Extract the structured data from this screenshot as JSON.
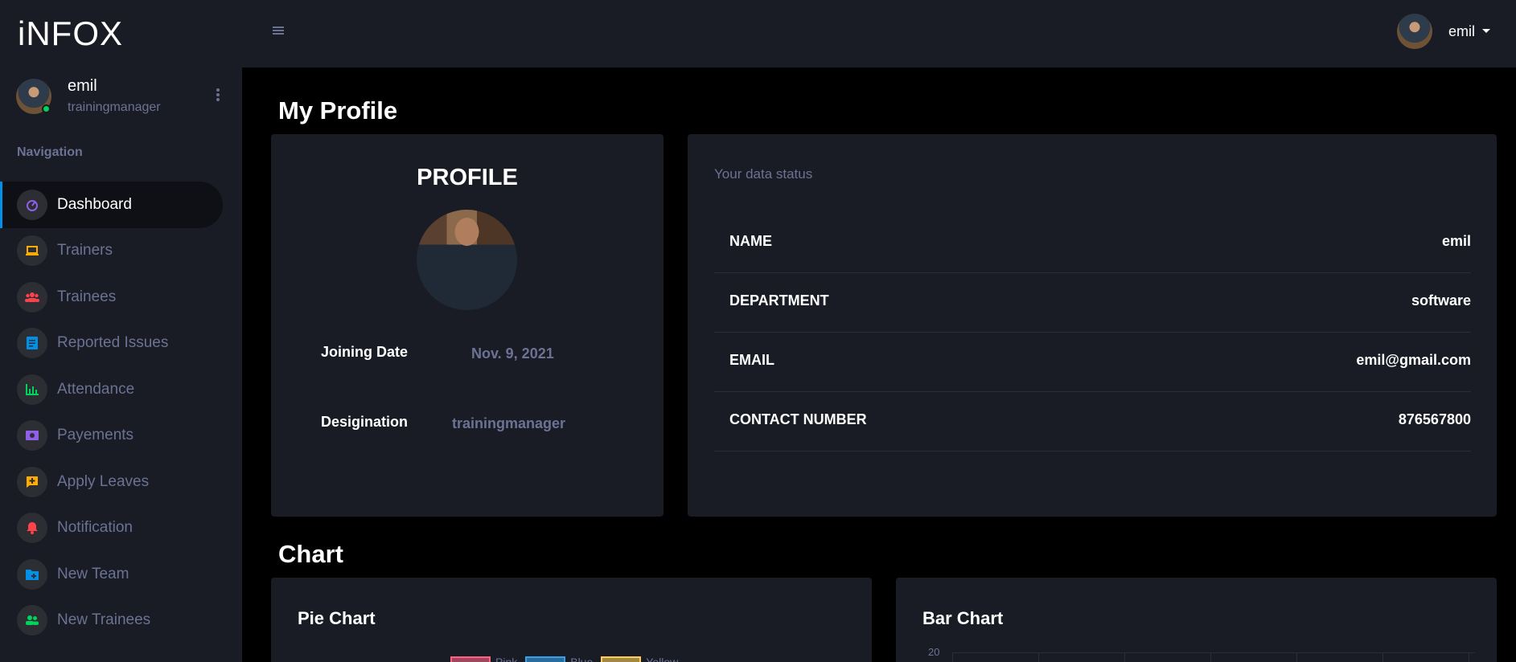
{
  "brand": "iNFOX",
  "user": {
    "name": "emil",
    "role": "trainingmanager"
  },
  "nav": {
    "label": "Navigation",
    "items": [
      {
        "label": "Dashboard",
        "icon": "speedometer-icon",
        "color": "#8f5fe8",
        "active": true
      },
      {
        "label": "Trainers",
        "icon": "laptop-icon",
        "color": "#ffab00"
      },
      {
        "label": "Trainees",
        "icon": "users-icon",
        "color": "#fc424a"
      },
      {
        "label": "Reported Issues",
        "icon": "document-icon",
        "color": "#0090e7"
      },
      {
        "label": "Attendance",
        "icon": "bar-chart-icon",
        "color": "#00d25b"
      },
      {
        "label": "Payements",
        "icon": "money-icon",
        "color": "#8f5fe8"
      },
      {
        "label": "Apply Leaves",
        "icon": "message-plus-icon",
        "color": "#ffab00"
      },
      {
        "label": "Notification",
        "icon": "bell-icon",
        "color": "#fc424a"
      },
      {
        "label": "New Team",
        "icon": "folder-plus-icon",
        "color": "#0090e7"
      },
      {
        "label": "New Trainees",
        "icon": "user-group-icon",
        "color": "#00d25b"
      }
    ]
  },
  "topbar": {
    "username": "emil"
  },
  "profile_section": {
    "title": "My Profile",
    "card_title": "PROFILE",
    "joining_date_label": "Joining Date",
    "joining_date_value": "Nov. 9, 2021",
    "designation_label": "Desigination",
    "designation_value": "trainingmanager"
  },
  "status": {
    "heading": "Your data status",
    "rows": [
      {
        "key": "NAME",
        "value": "emil"
      },
      {
        "key": "DEPARTMENT",
        "value": "software"
      },
      {
        "key": "EMAIL",
        "value": "emil@gmail.com"
      },
      {
        "key": "CONTACT NUMBER",
        "value": "876567800"
      }
    ]
  },
  "chart_section": {
    "title": "Chart",
    "pie_title": "Pie Chart",
    "bar_title": "Bar Chart"
  },
  "chart_data": [
    {
      "type": "pie",
      "title": "Pie Chart",
      "legend": [
        {
          "name": "Pink",
          "color": "#ff6384"
        },
        {
          "name": "Blue",
          "color": "#36a2eb"
        },
        {
          "name": "Yellow",
          "color": "#ffce56"
        }
      ]
    },
    {
      "type": "bar",
      "title": "Bar Chart",
      "y_ticks_visible": [
        20
      ]
    }
  ]
}
